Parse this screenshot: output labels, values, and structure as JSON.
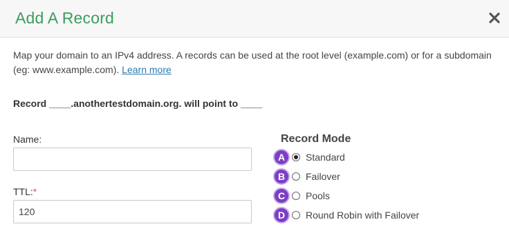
{
  "modal": {
    "title": "Add A Record",
    "close_icon": "close-icon",
    "description_text": "Map your domain to an IPv4 address. A records can be used at the root level (example.com) or for a subdomain (eg: www.example.com). ",
    "learn_more": "Learn more",
    "record_line": "Record ____.anothertestdomain.org. will point to ____"
  },
  "form": {
    "name_label": "Name:",
    "name_value": "",
    "ttl_label": "TTL:",
    "ttl_required_mark": "*",
    "ttl_value": "120"
  },
  "record_mode": {
    "title": "Record Mode",
    "options": [
      {
        "badge": "A",
        "label": "Standard",
        "checked": true
      },
      {
        "badge": "B",
        "label": "Failover",
        "checked": false
      },
      {
        "badge": "C",
        "label": "Pools",
        "checked": false
      },
      {
        "badge": "D",
        "label": "Round Robin with Failover",
        "checked": false
      }
    ]
  },
  "colors": {
    "title_green": "#3a9d5d",
    "link_blue": "#2a7bb0",
    "badge_purple": "#7b3fc4",
    "required_red": "#d9534f"
  }
}
